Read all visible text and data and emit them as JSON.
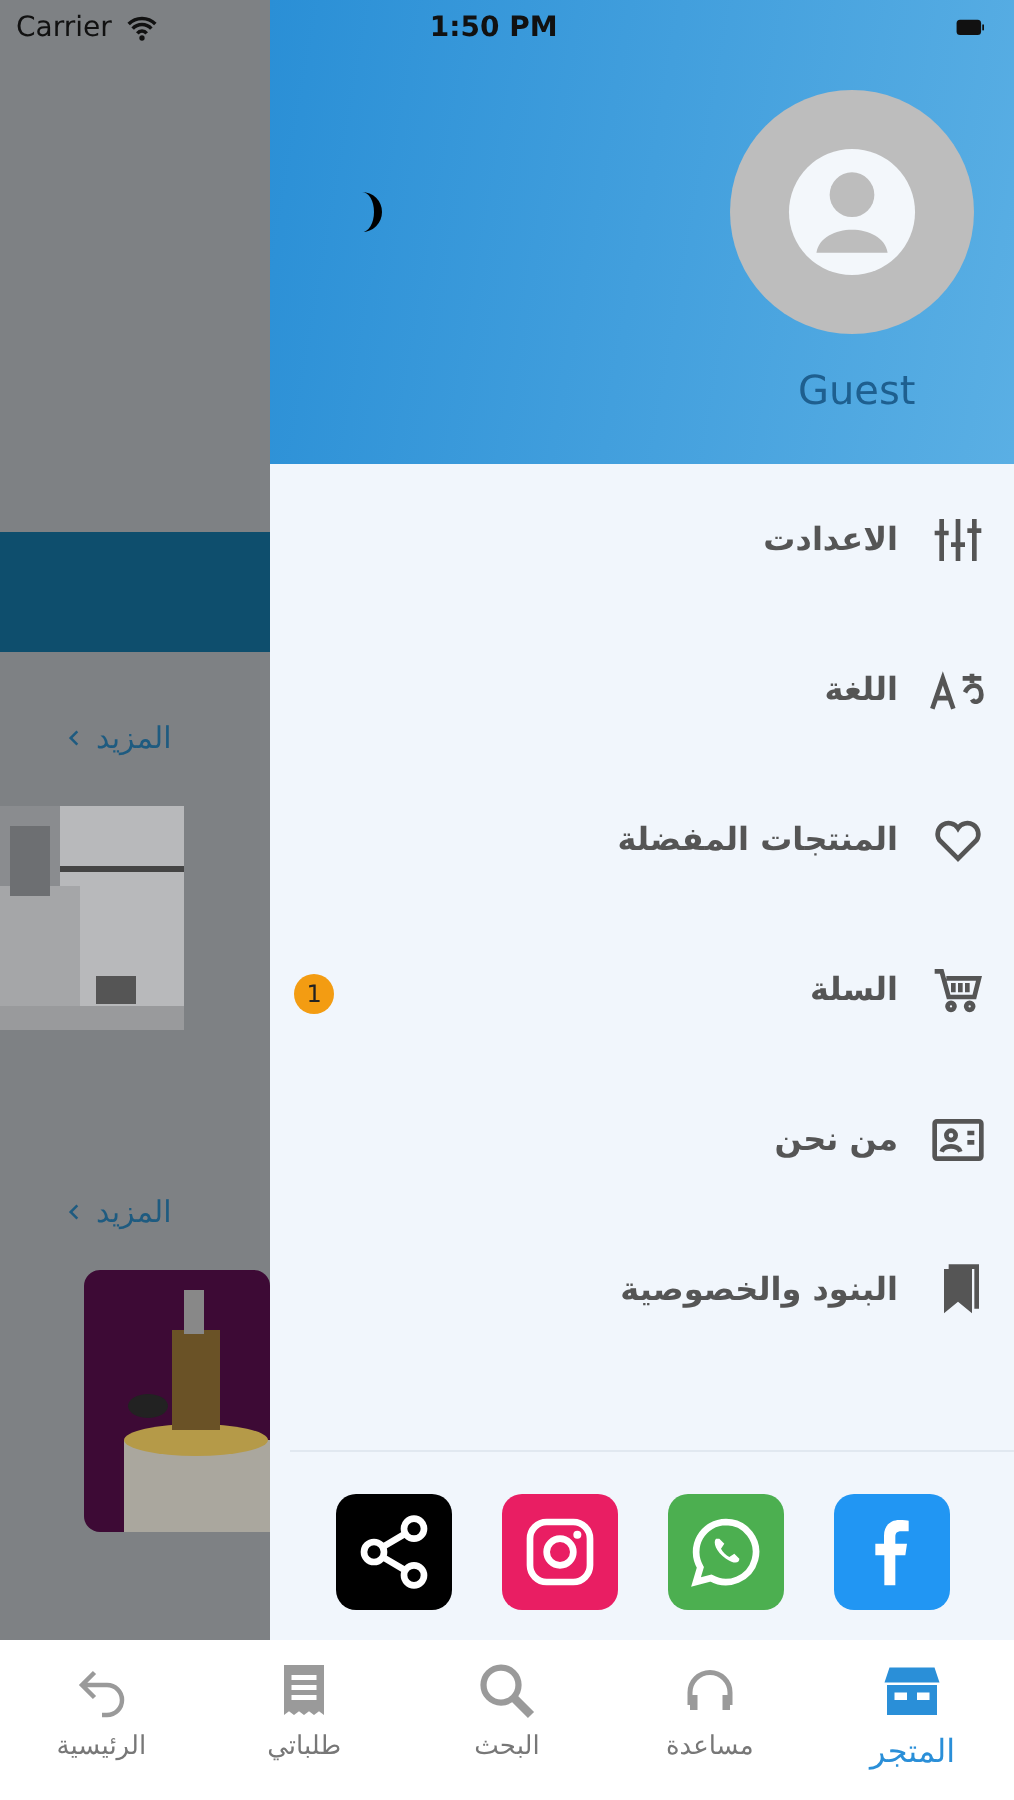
{
  "status_bar": {
    "carrier": "Carrier",
    "time": "1:50 PM"
  },
  "background_page": {
    "sections": [
      {
        "more_link": "المزيد"
      },
      {
        "more_link": "المزيد"
      }
    ]
  },
  "drawer": {
    "user_name": "Guest",
    "menu": [
      {
        "label": "الاعدادت",
        "kind": "sliders"
      },
      {
        "label": "اللغة",
        "kind": "language"
      },
      {
        "label": "المنتجات المفضلة",
        "kind": "heart"
      },
      {
        "label": "السلة",
        "kind": "cart",
        "badge": "1"
      },
      {
        "label": "من نحن",
        "kind": "contact"
      },
      {
        "label": "البنود والخصوصية",
        "kind": "bookmark"
      }
    ],
    "social": [
      {
        "kind": "facebook",
        "color": "#2196f3"
      },
      {
        "kind": "whatsapp",
        "color": "#4caf50"
      },
      {
        "kind": "instagram",
        "color": "#e91e63"
      },
      {
        "kind": "share",
        "color": "#000000"
      }
    ]
  },
  "tab_bar": [
    {
      "label": "المتجر",
      "kind": "store",
      "selected": true
    },
    {
      "label": "مساعدة",
      "kind": "headphones",
      "selected": false
    },
    {
      "label": "البحث",
      "kind": "search",
      "selected": false
    },
    {
      "label": "طلباتي",
      "kind": "receipt",
      "selected": false
    },
    {
      "label": "الرئيسية",
      "kind": "back",
      "selected": false
    }
  ]
}
